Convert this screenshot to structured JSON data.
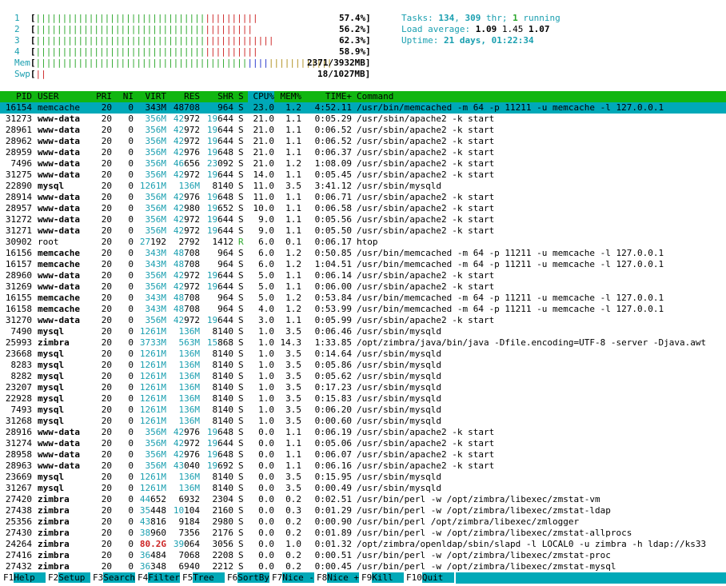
{
  "meters": {
    "cpus": [
      {
        "label": "1",
        "pct": "57.4%]",
        "green": 32,
        "red": 10
      },
      {
        "label": "2",
        "pct": "56.2%]",
        "green": 32,
        "red": 9
      },
      {
        "label": "3",
        "pct": "62.3%]",
        "green": 32,
        "red": 13
      },
      {
        "label": "4",
        "pct": "58.9%]",
        "green": 32,
        "red": 10
      }
    ],
    "mem": {
      "label": "Mem",
      "value": "2371/3932MB]"
    },
    "swp": {
      "label": "Swp",
      "value": "18/1027MB]"
    }
  },
  "summary": {
    "tasks_label": "Tasks: ",
    "tasks_count": "134",
    "tasks_sep": ", ",
    "threads": "309",
    "threads_suffix": " thr; ",
    "running": "1",
    "running_suffix": " running",
    "load_label": "Load average: ",
    "load1": "1.09",
    "load5": "1.45",
    "load15": "1.07",
    "uptime_label": "Uptime: ",
    "uptime": "21 days, 01:22:34"
  },
  "columns": [
    "PID",
    "USER",
    "PRI",
    "NI",
    "VIRT",
    "RES",
    "SHR",
    "S",
    "CPU%",
    "MEM%",
    "TIME+",
    "Command"
  ],
  "processes": [
    [
      "16154",
      "memcache",
      "20",
      "0",
      "343M",
      "48708",
      "964",
      "S",
      "23.0",
      "1.2",
      "4:52.11",
      "/usr/bin/memcached -m 64 -p 11211 -u memcache -l 127.0.0.1"
    ],
    [
      "31273",
      "www-data",
      "20",
      "0",
      "356M",
      "42972",
      "19644",
      "S",
      "21.0",
      "1.1",
      "0:05.29",
      "/usr/sbin/apache2 -k start"
    ],
    [
      "28961",
      "www-data",
      "20",
      "0",
      "356M",
      "42972",
      "19644",
      "S",
      "21.0",
      "1.1",
      "0:06.52",
      "/usr/sbin/apache2 -k start"
    ],
    [
      "28962",
      "www-data",
      "20",
      "0",
      "356M",
      "42972",
      "19644",
      "S",
      "21.0",
      "1.1",
      "0:06.52",
      "/usr/sbin/apache2 -k start"
    ],
    [
      "28959",
      "www-data",
      "20",
      "0",
      "356M",
      "42976",
      "19648",
      "S",
      "21.0",
      "1.1",
      "0:06.37",
      "/usr/sbin/apache2 -k start"
    ],
    [
      "7496",
      "www-data",
      "20",
      "0",
      "356M",
      "46656",
      "23092",
      "S",
      "21.0",
      "1.2",
      "1:08.09",
      "/usr/sbin/apache2 -k start"
    ],
    [
      "31275",
      "www-data",
      "20",
      "0",
      "356M",
      "42972",
      "19644",
      "S",
      "14.0",
      "1.1",
      "0:05.45",
      "/usr/sbin/apache2 -k start"
    ],
    [
      "22890",
      "mysql",
      "20",
      "0",
      "1261M",
      "136M",
      "8140",
      "S",
      "11.0",
      "3.5",
      "3:41.12",
      "/usr/sbin/mysqld"
    ],
    [
      "28914",
      "www-data",
      "20",
      "0",
      "356M",
      "42976",
      "19648",
      "S",
      "11.0",
      "1.1",
      "0:06.71",
      "/usr/sbin/apache2 -k start"
    ],
    [
      "28957",
      "www-data",
      "20",
      "0",
      "356M",
      "42980",
      "19652",
      "S",
      "10.0",
      "1.1",
      "0:06.58",
      "/usr/sbin/apache2 -k start"
    ],
    [
      "31272",
      "www-data",
      "20",
      "0",
      "356M",
      "42972",
      "19644",
      "S",
      "9.0",
      "1.1",
      "0:05.56",
      "/usr/sbin/apache2 -k start"
    ],
    [
      "31271",
      "www-data",
      "20",
      "0",
      "356M",
      "42972",
      "19644",
      "S",
      "9.0",
      "1.1",
      "0:05.50",
      "/usr/sbin/apache2 -k start"
    ],
    [
      "30902",
      "root",
      "20",
      "0",
      "27192",
      "2792",
      "1412",
      "R",
      "6.0",
      "0.1",
      "0:06.17",
      "htop"
    ],
    [
      "16156",
      "memcache",
      "20",
      "0",
      "343M",
      "48708",
      "964",
      "S",
      "6.0",
      "1.2",
      "0:50.85",
      "/usr/bin/memcached -m 64 -p 11211 -u memcache -l 127.0.0.1"
    ],
    [
      "16157",
      "memcache",
      "20",
      "0",
      "343M",
      "48708",
      "964",
      "S",
      "6.0",
      "1.2",
      "1:04.51",
      "/usr/bin/memcached -m 64 -p 11211 -u memcache -l 127.0.0.1"
    ],
    [
      "28960",
      "www-data",
      "20",
      "0",
      "356M",
      "42972",
      "19644",
      "S",
      "5.0",
      "1.1",
      "0:06.14",
      "/usr/sbin/apache2 -k start"
    ],
    [
      "31269",
      "www-data",
      "20",
      "0",
      "356M",
      "42972",
      "19644",
      "S",
      "5.0",
      "1.1",
      "0:06.00",
      "/usr/sbin/apache2 -k start"
    ],
    [
      "16155",
      "memcache",
      "20",
      "0",
      "343M",
      "48708",
      "964",
      "S",
      "5.0",
      "1.2",
      "0:53.84",
      "/usr/bin/memcached -m 64 -p 11211 -u memcache -l 127.0.0.1"
    ],
    [
      "16158",
      "memcache",
      "20",
      "0",
      "343M",
      "48708",
      "964",
      "S",
      "4.0",
      "1.2",
      "0:53.99",
      "/usr/bin/memcached -m 64 -p 11211 -u memcache -l 127.0.0.1"
    ],
    [
      "31270",
      "www-data",
      "20",
      "0",
      "356M",
      "42972",
      "19644",
      "S",
      "3.0",
      "1.1",
      "0:05.99",
      "/usr/sbin/apache2 -k start"
    ],
    [
      "7490",
      "mysql",
      "20",
      "0",
      "1261M",
      "136M",
      "8140",
      "S",
      "1.0",
      "3.5",
      "0:06.46",
      "/usr/sbin/mysqld"
    ],
    [
      "25993",
      "zimbra",
      "20",
      "0",
      "3733M",
      "563M",
      "15868",
      "S",
      "1.0",
      "14.3",
      "1:33.85",
      "/opt/zimbra/java/bin/java -Dfile.encoding=UTF-8 -server -Djava.awt"
    ],
    [
      "23668",
      "mysql",
      "20",
      "0",
      "1261M",
      "136M",
      "8140",
      "S",
      "1.0",
      "3.5",
      "0:14.64",
      "/usr/sbin/mysqld"
    ],
    [
      "8283",
      "mysql",
      "20",
      "0",
      "1261M",
      "136M",
      "8140",
      "S",
      "1.0",
      "3.5",
      "0:05.86",
      "/usr/sbin/mysqld"
    ],
    [
      "8282",
      "mysql",
      "20",
      "0",
      "1261M",
      "136M",
      "8140",
      "S",
      "1.0",
      "3.5",
      "0:05.62",
      "/usr/sbin/mysqld"
    ],
    [
      "23207",
      "mysql",
      "20",
      "0",
      "1261M",
      "136M",
      "8140",
      "S",
      "1.0",
      "3.5",
      "0:17.23",
      "/usr/sbin/mysqld"
    ],
    [
      "22928",
      "mysql",
      "20",
      "0",
      "1261M",
      "136M",
      "8140",
      "S",
      "1.0",
      "3.5",
      "0:15.83",
      "/usr/sbin/mysqld"
    ],
    [
      "7493",
      "mysql",
      "20",
      "0",
      "1261M",
      "136M",
      "8140",
      "S",
      "1.0",
      "3.5",
      "0:06.20",
      "/usr/sbin/mysqld"
    ],
    [
      "31268",
      "mysql",
      "20",
      "0",
      "1261M",
      "136M",
      "8140",
      "S",
      "1.0",
      "3.5",
      "0:00.60",
      "/usr/sbin/mysqld"
    ],
    [
      "28916",
      "www-data",
      "20",
      "0",
      "356M",
      "42976",
      "19648",
      "S",
      "0.0",
      "1.1",
      "0:06.19",
      "/usr/sbin/apache2 -k start"
    ],
    [
      "31274",
      "www-data",
      "20",
      "0",
      "356M",
      "42972",
      "19644",
      "S",
      "0.0",
      "1.1",
      "0:05.06",
      "/usr/sbin/apache2 -k start"
    ],
    [
      "28958",
      "www-data",
      "20",
      "0",
      "356M",
      "42976",
      "19648",
      "S",
      "0.0",
      "1.1",
      "0:06.07",
      "/usr/sbin/apache2 -k start"
    ],
    [
      "28963",
      "www-data",
      "20",
      "0",
      "356M",
      "43040",
      "19692",
      "S",
      "0.0",
      "1.1",
      "0:06.16",
      "/usr/sbin/apache2 -k start"
    ],
    [
      "23669",
      "mysql",
      "20",
      "0",
      "1261M",
      "136M",
      "8140",
      "S",
      "0.0",
      "3.5",
      "0:15.95",
      "/usr/sbin/mysqld"
    ],
    [
      "31267",
      "mysql",
      "20",
      "0",
      "1261M",
      "136M",
      "8140",
      "S",
      "0.0",
      "3.5",
      "0:00.49",
      "/usr/sbin/mysqld"
    ],
    [
      "27420",
      "zimbra",
      "20",
      "0",
      "44652",
      "6932",
      "2304",
      "S",
      "0.0",
      "0.2",
      "0:02.51",
      "/usr/bin/perl -w /opt/zimbra/libexec/zmstat-vm"
    ],
    [
      "27438",
      "zimbra",
      "20",
      "0",
      "35448",
      "10104",
      "2160",
      "S",
      "0.0",
      "0.3",
      "0:01.29",
      "/usr/bin/perl -w /opt/zimbra/libexec/zmstat-ldap"
    ],
    [
      "25356",
      "zimbra",
      "20",
      "0",
      "43816",
      "9184",
      "2980",
      "S",
      "0.0",
      "0.2",
      "0:00.90",
      "/usr/bin/perl /opt/zimbra/libexec/zmlogger"
    ],
    [
      "27430",
      "zimbra",
      "20",
      "0",
      "38960",
      "7356",
      "2176",
      "S",
      "0.0",
      "0.2",
      "0:01.89",
      "/usr/bin/perl -w /opt/zimbra/libexec/zmstat-allprocs"
    ],
    [
      "24264",
      "zimbra",
      "20",
      "0",
      "80.2G",
      "39064",
      "3056",
      "S",
      "0.0",
      "1.0",
      "0:01.32",
      "/opt/zimbra/openldap/sbin/slapd -l LOCAL0 -u zimbra -h ldap://ks33"
    ],
    [
      "27416",
      "zimbra",
      "20",
      "0",
      "36484",
      "7068",
      "2208",
      "S",
      "0.0",
      "0.2",
      "0:00.51",
      "/usr/bin/perl -w /opt/zimbra/libexec/zmstat-proc"
    ],
    [
      "27432",
      "zimbra",
      "20",
      "0",
      "36348",
      "6940",
      "2212",
      "S",
      "0.0",
      "0.2",
      "0:00.45",
      "/usr/bin/perl -w /opt/zimbra/libexec/zmstat-mysql"
    ]
  ],
  "footer": [
    {
      "key": "F1",
      "label": "Help  "
    },
    {
      "key": "F2",
      "label": "Setup "
    },
    {
      "key": "F3",
      "label": "Search"
    },
    {
      "key": "F4",
      "label": "Filter"
    },
    {
      "key": "F5",
      "label": "Tree  "
    },
    {
      "key": "F6",
      "label": "SortBy"
    },
    {
      "key": "F7",
      "label": "Nice -"
    },
    {
      "key": "F8",
      "label": "Nice +"
    },
    {
      "key": "F9",
      "label": "Kill  "
    },
    {
      "key": "F10",
      "label": "Quit  "
    }
  ],
  "colors": {
    "header_bg": "#11b611",
    "selection_bg": "#00a9b8",
    "accent": "#1a9fb0"
  }
}
